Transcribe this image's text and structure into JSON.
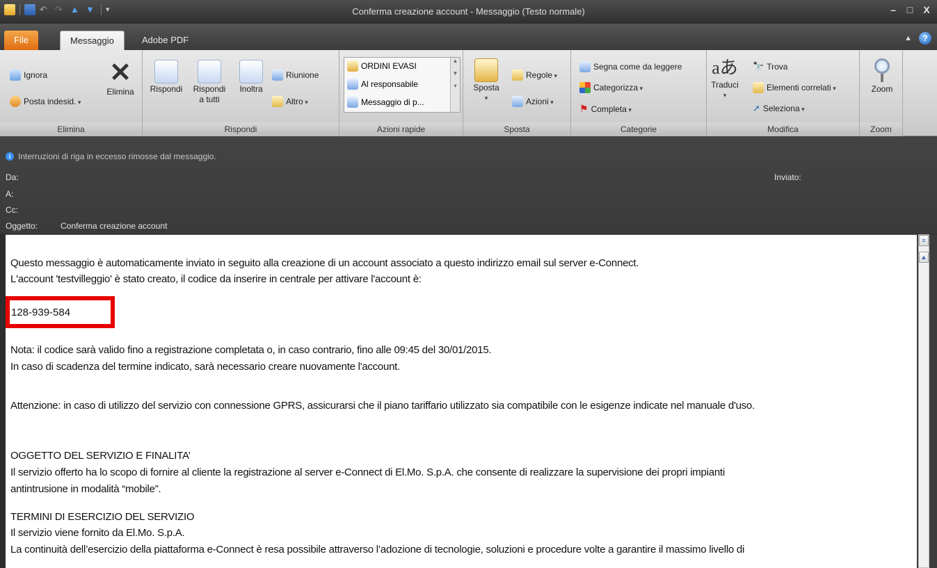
{
  "window": {
    "title": "Conferma creazione account - Messaggio (Testo normale)",
    "controls": [
      "–",
      "□",
      "X"
    ]
  },
  "tabs": {
    "file": "File",
    "messaggio": "Messaggio",
    "adobe_pdf": "Adobe PDF",
    "help": "?"
  },
  "ribbon": {
    "elimina": {
      "label": "Elimina",
      "ignora": "Ignora",
      "posta_indesid": "Posta indesid.",
      "elimina_btn": "Elimina"
    },
    "rispondi": {
      "label": "Rispondi",
      "rispondi": "Rispondi",
      "rispondi_tutti_1": "Rispondi",
      "rispondi_tutti_2": "a tutti",
      "inoltra": "Inoltra",
      "riunione": "Riunione",
      "altro": "Altro"
    },
    "azioni_rapide": {
      "label": "Azioni rapide",
      "items": [
        "ORDINI EVASI",
        "Al responsabile",
        "Messaggio di p..."
      ]
    },
    "sposta": {
      "label": "Sposta",
      "sposta": "Sposta",
      "regole": "Regole",
      "azioni": "Azioni"
    },
    "categorie": {
      "label": "Categorie",
      "segna": "Segna come da leggere",
      "categorizza": "Categorizza",
      "completa": "Completa"
    },
    "modifica": {
      "label": "Modifica",
      "traduci": "Traduci",
      "trova": "Trova",
      "elementi": "Elementi correlati",
      "seleziona": "Seleziona"
    },
    "zoom": {
      "label": "Zoom",
      "zoom": "Zoom"
    }
  },
  "header": {
    "info": "Interruzioni di riga in eccesso rimosse dal messaggio.",
    "da": "Da:",
    "a": "A:",
    "cc": "Cc:",
    "oggetto_label": "Oggetto:",
    "oggetto_value": "Conferma creazione account",
    "inviato": "Inviato:"
  },
  "body": {
    "line1": "Questo messaggio è automaticamente inviato in seguito alla creazione di un account associato a questo indirizzo email sul server e-Connect.",
    "line2": "L'account 'testvilleggio' è stato creato, il codice da inserire in centrale per attivare l'account è:",
    "code": "128-939-584",
    "nota1": "Nota: il codice sarà valido fino a registrazione completata o, in caso contrario, fino alle 09:45 del 30/01/2015.",
    "nota2": "In caso di scadenza del termine indicato, sarà necessario creare nuovamente l'account.",
    "attenzione": "Attenzione: in caso di utilizzo del servizio con connessione GPRS, assicurarsi che il piano tariffario utilizzato sia compatibile con le esigenze indicate nel manuale d'uso.",
    "oggetto_heading": "OGGETTO DEL SERVIZIO E FINALITA’",
    "oggetto_text1": "Il servizio offerto ha lo scopo di fornire al cliente la registrazione al server e-Connect di El.Mo. S.p.A. che consente di realizzare la supervisione dei propri impianti",
    "oggetto_text2": "antintrusione in modalità “mobile”.",
    "termini_heading": "TERMINI DI ESERCIZIO DEL SERVIZIO",
    "termini_text1": "Il servizio viene fornito da El.Mo. S.p.A.",
    "termini_text2": "La continuità dell’esercizio della piattaforma e-Connect è resa possibile attraverso l’adozione di tecnologie, soluzioni e procedure volte a garantire il massimo livello di"
  }
}
